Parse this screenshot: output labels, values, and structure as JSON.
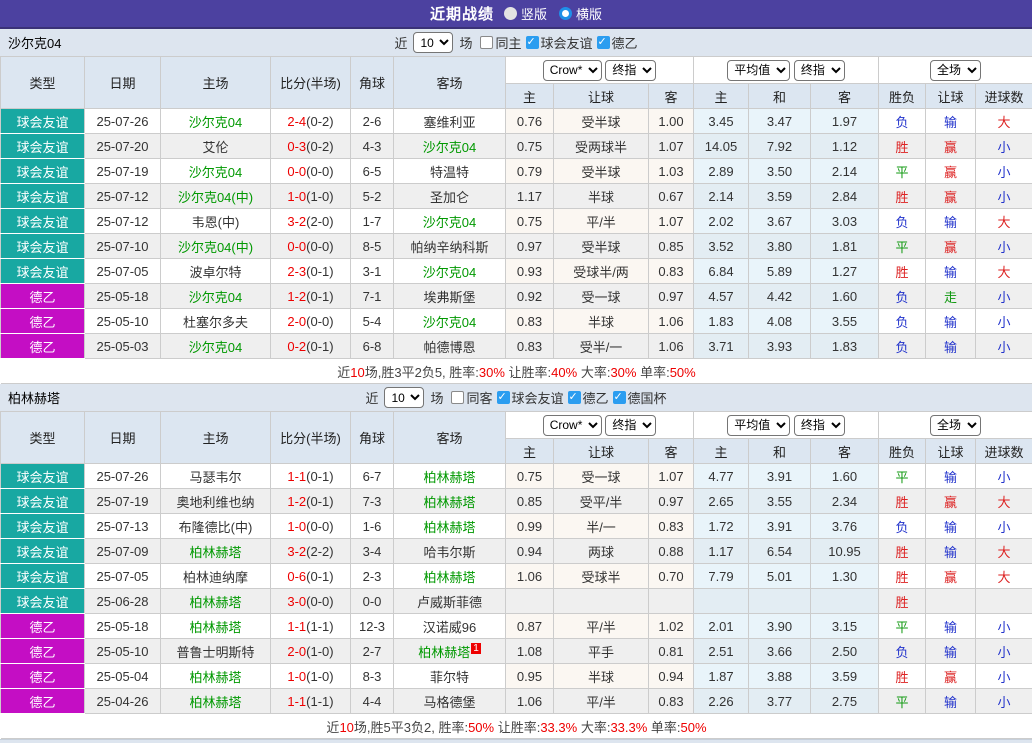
{
  "title_bar": {
    "title": "近期战绩",
    "radios": [
      {
        "label": "竖版",
        "selected": false
      },
      {
        "label": "横版",
        "selected": true
      }
    ]
  },
  "colors": {
    "brand_purple": "#4c41a0",
    "friendly_teal": "#18a8a2",
    "league_magenta": "#c40ec4",
    "team_green": "#009900",
    "win_red": "#dd2222",
    "lose_blue": "#2233cc",
    "draw_green": "#119911",
    "score_red": "#ee0000"
  },
  "table_headers": {
    "col_type": "类型",
    "col_date": "日期",
    "col_home": "主场",
    "col_score": "比分(半场)",
    "col_corner": "角球",
    "col_away": "客场",
    "sub": [
      "主",
      "让球",
      "客",
      "主",
      "和",
      "客",
      "胜负",
      "让球",
      "进球数"
    ]
  },
  "sections": [
    {
      "team": "沙尔克04",
      "filters": {
        "near": "近",
        "count": "10",
        "unit": "场",
        "checkboxes": [
          {
            "label": "同主",
            "checked": false
          },
          {
            "label": "球会友谊",
            "checked": true
          },
          {
            "label": "德乙",
            "checked": true
          }
        ]
      },
      "dropdowns": {
        "odds_source": "Crow*",
        "odds_stage1": "终指",
        "avg": "平均值",
        "odds_stage2": "终指",
        "scope": "全场"
      },
      "rows": [
        {
          "comp": "球会友谊",
          "date": "25-07-26",
          "home": "沙尔克04",
          "home_team": true,
          "score": "2-4",
          "half": "(0-2)",
          "corner": "2-6",
          "away": "塞维利亚",
          "away_team": false,
          "crow": [
            "0.76",
            "受半球",
            "1.00"
          ],
          "avg": [
            "3.45",
            "3.47",
            "1.97"
          ],
          "res": "负",
          "hcp": "输",
          "goal": "大"
        },
        {
          "comp": "球会友谊",
          "date": "25-07-20",
          "home": "艾伦",
          "home_team": false,
          "score": "0-3",
          "half": "(0-2)",
          "corner": "4-3",
          "away": "沙尔克04",
          "away_team": true,
          "crow": [
            "0.75",
            "受两球半",
            "1.07"
          ],
          "avg": [
            "14.05",
            "7.92",
            "1.12"
          ],
          "res": "胜",
          "hcp": "赢",
          "goal": "小"
        },
        {
          "comp": "球会友谊",
          "date": "25-07-19",
          "home": "沙尔克04",
          "home_team": true,
          "score": "0-0",
          "half": "(0-0)",
          "corner": "6-5",
          "away": "特温特",
          "away_team": false,
          "crow": [
            "0.79",
            "受半球",
            "1.03"
          ],
          "avg": [
            "2.89",
            "3.50",
            "2.14"
          ],
          "res": "平",
          "hcp": "赢",
          "goal": "小"
        },
        {
          "comp": "球会友谊",
          "date": "25-07-12",
          "home": "沙尔克04(中)",
          "home_team": true,
          "score": "1-0",
          "half": "(1-0)",
          "corner": "5-2",
          "away": "圣加仑",
          "away_team": false,
          "crow": [
            "1.17",
            "半球",
            "0.67"
          ],
          "avg": [
            "2.14",
            "3.59",
            "2.84"
          ],
          "res": "胜",
          "hcp": "赢",
          "goal": "小"
        },
        {
          "comp": "球会友谊",
          "date": "25-07-12",
          "home": "韦恩(中)",
          "home_team": false,
          "score": "3-2",
          "half": "(2-0)",
          "corner": "1-7",
          "away": "沙尔克04",
          "away_team": true,
          "crow": [
            "0.75",
            "平/半",
            "1.07"
          ],
          "avg": [
            "2.02",
            "3.67",
            "3.03"
          ],
          "res": "负",
          "hcp": "输",
          "goal": "大"
        },
        {
          "comp": "球会友谊",
          "date": "25-07-10",
          "home": "沙尔克04(中)",
          "home_team": true,
          "score": "0-0",
          "half": "(0-0)",
          "corner": "8-5",
          "away": "帕纳辛纳科斯",
          "away_team": false,
          "crow": [
            "0.97",
            "受半球",
            "0.85"
          ],
          "avg": [
            "3.52",
            "3.80",
            "1.81"
          ],
          "res": "平",
          "hcp": "赢",
          "goal": "小"
        },
        {
          "comp": "球会友谊",
          "date": "25-07-05",
          "home": "波卓尔特",
          "home_team": false,
          "score": "2-3",
          "half": "(0-1)",
          "corner": "3-1",
          "away": "沙尔克04",
          "away_team": true,
          "crow": [
            "0.93",
            "受球半/两",
            "0.83"
          ],
          "avg": [
            "6.84",
            "5.89",
            "1.27"
          ],
          "res": "胜",
          "hcp": "输",
          "goal": "大"
        },
        {
          "comp": "德乙",
          "date": "25-05-18",
          "home": "沙尔克04",
          "home_team": true,
          "score": "1-2",
          "half": "(0-1)",
          "corner": "7-1",
          "away": "埃弗斯堡",
          "away_team": false,
          "crow": [
            "0.92",
            "受一球",
            "0.97"
          ],
          "avg": [
            "4.57",
            "4.42",
            "1.60"
          ],
          "res": "负",
          "hcp": "走",
          "goal": "小"
        },
        {
          "comp": "德乙",
          "date": "25-05-10",
          "home": "杜塞尔多夫",
          "home_team": false,
          "score": "2-0",
          "half": "(0-0)",
          "corner": "5-4",
          "away": "沙尔克04",
          "away_team": true,
          "crow": [
            "0.83",
            "半球",
            "1.06"
          ],
          "avg": [
            "1.83",
            "4.08",
            "3.55"
          ],
          "res": "负",
          "hcp": "输",
          "goal": "小"
        },
        {
          "comp": "德乙",
          "date": "25-05-03",
          "home": "沙尔克04",
          "home_team": true,
          "score": "0-2",
          "half": "(0-1)",
          "corner": "6-8",
          "away": "帕德博恩",
          "away_team": false,
          "crow": [
            "0.83",
            "受半/一",
            "1.06"
          ],
          "avg": [
            "3.71",
            "3.93",
            "1.83"
          ],
          "res": "负",
          "hcp": "输",
          "goal": "小"
        }
      ],
      "summary": {
        "lead": [
          [
            "近",
            "t"
          ],
          [
            "10",
            "n"
          ],
          [
            "场,胜3平2负5, ",
            "t"
          ]
        ],
        "stats": [
          {
            "label": "胜率:",
            "value": "30%"
          },
          {
            "label": "让胜率:",
            "value": "40%"
          },
          {
            "label": "大率:",
            "value": "30%"
          },
          {
            "label": "单率:",
            "value": "50%"
          }
        ]
      }
    },
    {
      "team": "柏林赫塔",
      "filters": {
        "near": "近",
        "count": "10",
        "unit": "场",
        "checkboxes": [
          {
            "label": "同客",
            "checked": false
          },
          {
            "label": "球会友谊",
            "checked": true
          },
          {
            "label": "德乙",
            "checked": true
          },
          {
            "label": "德国杯",
            "checked": true
          }
        ]
      },
      "dropdowns": {
        "odds_source": "Crow*",
        "odds_stage1": "终指",
        "avg": "平均值",
        "odds_stage2": "终指",
        "scope": "全场"
      },
      "rows": [
        {
          "comp": "球会友谊",
          "date": "25-07-26",
          "home": "马瑟韦尔",
          "home_team": false,
          "score": "1-1",
          "half": "(0-1)",
          "corner": "6-7",
          "away": "柏林赫塔",
          "away_team": true,
          "crow": [
            "0.75",
            "受一球",
            "1.07"
          ],
          "avg": [
            "4.77",
            "3.91",
            "1.60"
          ],
          "res": "平",
          "hcp": "输",
          "goal": "小"
        },
        {
          "comp": "球会友谊",
          "date": "25-07-19",
          "home": "奥地利维也纳",
          "home_team": false,
          "score": "1-2",
          "half": "(0-1)",
          "corner": "7-3",
          "away": "柏林赫塔",
          "away_team": true,
          "crow": [
            "0.85",
            "受平/半",
            "0.97"
          ],
          "avg": [
            "2.65",
            "3.55",
            "2.34"
          ],
          "res": "胜",
          "hcp": "赢",
          "goal": "大"
        },
        {
          "comp": "球会友谊",
          "date": "25-07-13",
          "home": "布隆德比(中)",
          "home_team": false,
          "score": "1-0",
          "half": "(0-0)",
          "corner": "1-6",
          "away": "柏林赫塔",
          "away_team": true,
          "crow": [
            "0.99",
            "半/一",
            "0.83"
          ],
          "avg": [
            "1.72",
            "3.91",
            "3.76"
          ],
          "res": "负",
          "hcp": "输",
          "goal": "小"
        },
        {
          "comp": "球会友谊",
          "date": "25-07-09",
          "home": "柏林赫塔",
          "home_team": true,
          "score": "3-2",
          "half": "(2-2)",
          "corner": "3-4",
          "away": "哈韦尔斯",
          "away_team": false,
          "crow": [
            "0.94",
            "两球",
            "0.88"
          ],
          "avg": [
            "1.17",
            "6.54",
            "10.95"
          ],
          "res": "胜",
          "hcp": "输",
          "goal": "大"
        },
        {
          "comp": "球会友谊",
          "date": "25-07-05",
          "home": "柏林迪纳摩",
          "home_team": false,
          "score": "0-6",
          "half": "(0-1)",
          "corner": "2-3",
          "away": "柏林赫塔",
          "away_team": true,
          "crow": [
            "1.06",
            "受球半",
            "0.70"
          ],
          "avg": [
            "7.79",
            "5.01",
            "1.30"
          ],
          "res": "胜",
          "hcp": "赢",
          "goal": "大"
        },
        {
          "comp": "球会友谊",
          "date": "25-06-28",
          "home": "柏林赫塔",
          "home_team": true,
          "score": "3-0",
          "half": "(0-0)",
          "corner": "0-0",
          "away": "卢威斯菲德",
          "away_team": false,
          "crow": [
            "",
            "",
            ""
          ],
          "avg": [
            "",
            "",
            ""
          ],
          "res": "胜",
          "hcp": "",
          "goal": ""
        },
        {
          "comp": "德乙",
          "date": "25-05-18",
          "home": "柏林赫塔",
          "home_team": true,
          "score": "1-1",
          "half": "(1-1)",
          "corner": "12-3",
          "away": "汉诺威96",
          "away_team": false,
          "crow": [
            "0.87",
            "平/半",
            "1.02"
          ],
          "avg": [
            "2.01",
            "3.90",
            "3.15"
          ],
          "res": "平",
          "hcp": "输",
          "goal": "小"
        },
        {
          "comp": "德乙",
          "date": "25-05-10",
          "home": "普鲁士明斯特",
          "home_team": false,
          "score": "2-0",
          "half": "(1-0)",
          "corner": "2-7",
          "away": "柏林赫塔",
          "away_team": true,
          "away_badge": "1",
          "crow": [
            "1.08",
            "平手",
            "0.81"
          ],
          "avg": [
            "2.51",
            "3.66",
            "2.50"
          ],
          "res": "负",
          "hcp": "输",
          "goal": "小"
        },
        {
          "comp": "德乙",
          "date": "25-05-04",
          "home": "柏林赫塔",
          "home_team": true,
          "score": "1-0",
          "half": "(1-0)",
          "corner": "8-3",
          "away": "菲尔特",
          "away_team": false,
          "crow": [
            "0.95",
            "半球",
            "0.94"
          ],
          "avg": [
            "1.87",
            "3.88",
            "3.59"
          ],
          "res": "胜",
          "hcp": "赢",
          "goal": "小"
        },
        {
          "comp": "德乙",
          "date": "25-04-26",
          "home": "柏林赫塔",
          "home_team": true,
          "score": "1-1",
          "half": "(1-1)",
          "corner": "4-4",
          "away": "马格德堡",
          "away_team": false,
          "crow": [
            "1.06",
            "平/半",
            "0.83"
          ],
          "avg": [
            "2.26",
            "3.77",
            "2.75"
          ],
          "res": "平",
          "hcp": "输",
          "goal": "小"
        }
      ],
      "summary": {
        "lead": [
          [
            "近",
            "t"
          ],
          [
            "10",
            "n"
          ],
          [
            "场,胜5平3负2, ",
            "t"
          ]
        ],
        "stats": [
          {
            "label": "胜率:",
            "value": "50%"
          },
          {
            "label": "让胜率:",
            "value": "33.3%"
          },
          {
            "label": "大率:",
            "value": "33.3%"
          },
          {
            "label": "单率:",
            "value": "50%"
          }
        ]
      }
    }
  ]
}
